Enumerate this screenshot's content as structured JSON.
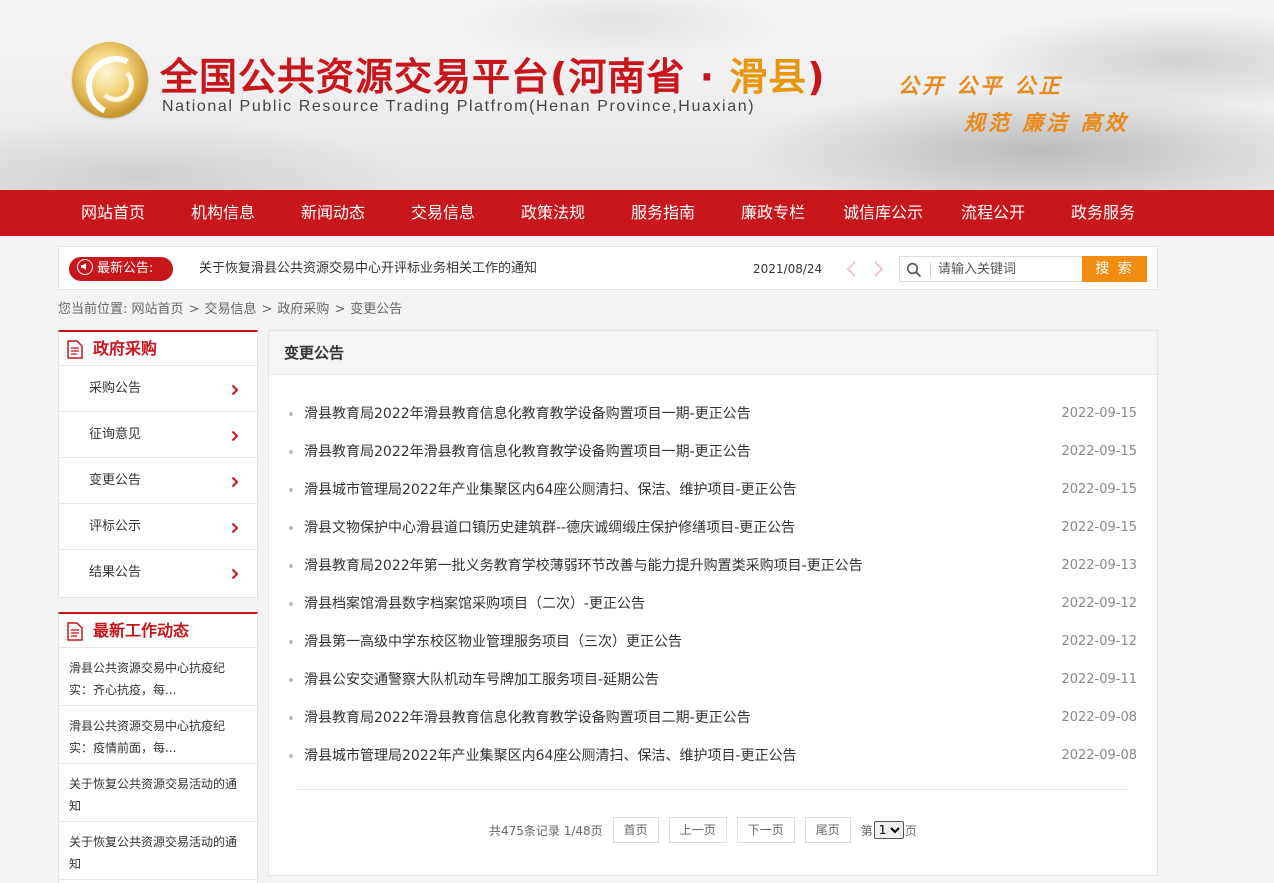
{
  "header": {
    "title_main": "全国公共资源交易平台(河南省 · ",
    "title_highlight": "滑县",
    "title_end": ")",
    "subtitle": "National Public Resource Trading Platfrom(Henan Province,Huaxian)",
    "slogan_line1": "公开 公平 公正",
    "slogan_line2": "规范 廉洁 高效"
  },
  "nav": {
    "items": [
      "网站首页",
      "机构信息",
      "新闻动态",
      "交易信息",
      "政策法规",
      "服务指南",
      "廉政专栏",
      "诚信库公示",
      "流程公开",
      "政务服务"
    ]
  },
  "notice": {
    "badge_label": "最新公告:",
    "text": "关于恢复滑县公共资源交易中心开评标业务相关工作的通知",
    "date": "2021/08/24",
    "search_placeholder": "请输入关键词",
    "search_button": "搜 索"
  },
  "breadcrumb": {
    "prefix": "您当前位置:",
    "items": [
      "网站首页",
      "交易信息",
      "政府采购",
      "变更公告"
    ]
  },
  "sidebar": {
    "category_title": "政府采购",
    "category_items": [
      "采购公告",
      "征询意见",
      "变更公告",
      "评标公示",
      "结果公告"
    ],
    "news_title": "最新工作动态",
    "news_items": [
      "滑县公共资源交易中心抗疫纪实：齐心抗疫，每...",
      "滑县公共资源交易中心抗疫纪实：疫情前面，每...",
      "关于恢复公共资源交易活动的通知",
      "关于恢复公共资源交易活动的通知"
    ]
  },
  "main": {
    "heading": "变更公告",
    "rows": [
      {
        "title": "滑县教育局2022年滑县教育信息化教育教学设备购置项目一期-更正公告",
        "date": "2022-09-15"
      },
      {
        "title": "滑县教育局2022年滑县教育信息化教育教学设备购置项目一期-更正公告",
        "date": "2022-09-15"
      },
      {
        "title": "滑县城市管理局2022年产业集聚区内64座公厕清扫、保洁、维护项目-更正公告",
        "date": "2022-09-15"
      },
      {
        "title": "滑县文物保护中心滑县道口镇历史建筑群--德庆诚绸缎庄保护修缮项目-更正公告",
        "date": "2022-09-15"
      },
      {
        "title": "滑县教育局2022年第一批义务教育学校薄弱环节改善与能力提升购置类采购项目-更正公告",
        "date": "2022-09-13"
      },
      {
        "title": "滑县档案馆滑县数字档案馆采购项目（二次）-更正公告",
        "date": "2022-09-12"
      },
      {
        "title": "滑县第一高级中学东校区物业管理服务项目（三次）更正公告",
        "date": "2022-09-12"
      },
      {
        "title": "滑县公安交通警察大队机动车号牌加工服务项目-延期公告",
        "date": "2022-09-11"
      },
      {
        "title": "滑县教育局2022年滑县教育信息化教育教学设备购置项目二期-更正公告",
        "date": "2022-09-08"
      },
      {
        "title": "滑县城市管理局2022年产业集聚区内64座公厕清扫、保洁、维护项目-更正公告",
        "date": "2022-09-08"
      }
    ],
    "pager": {
      "info": "共475条记录 1/48页",
      "first": "首页",
      "prev": "上一页",
      "next": "下一页",
      "last": "尾页",
      "page_prefix": "第",
      "page_value": "1",
      "page_suffix": "页"
    }
  },
  "colors": {
    "brand_red": "#c8161d",
    "accent_orange": "#f08c11",
    "slogan_orange": "#e8891a"
  }
}
